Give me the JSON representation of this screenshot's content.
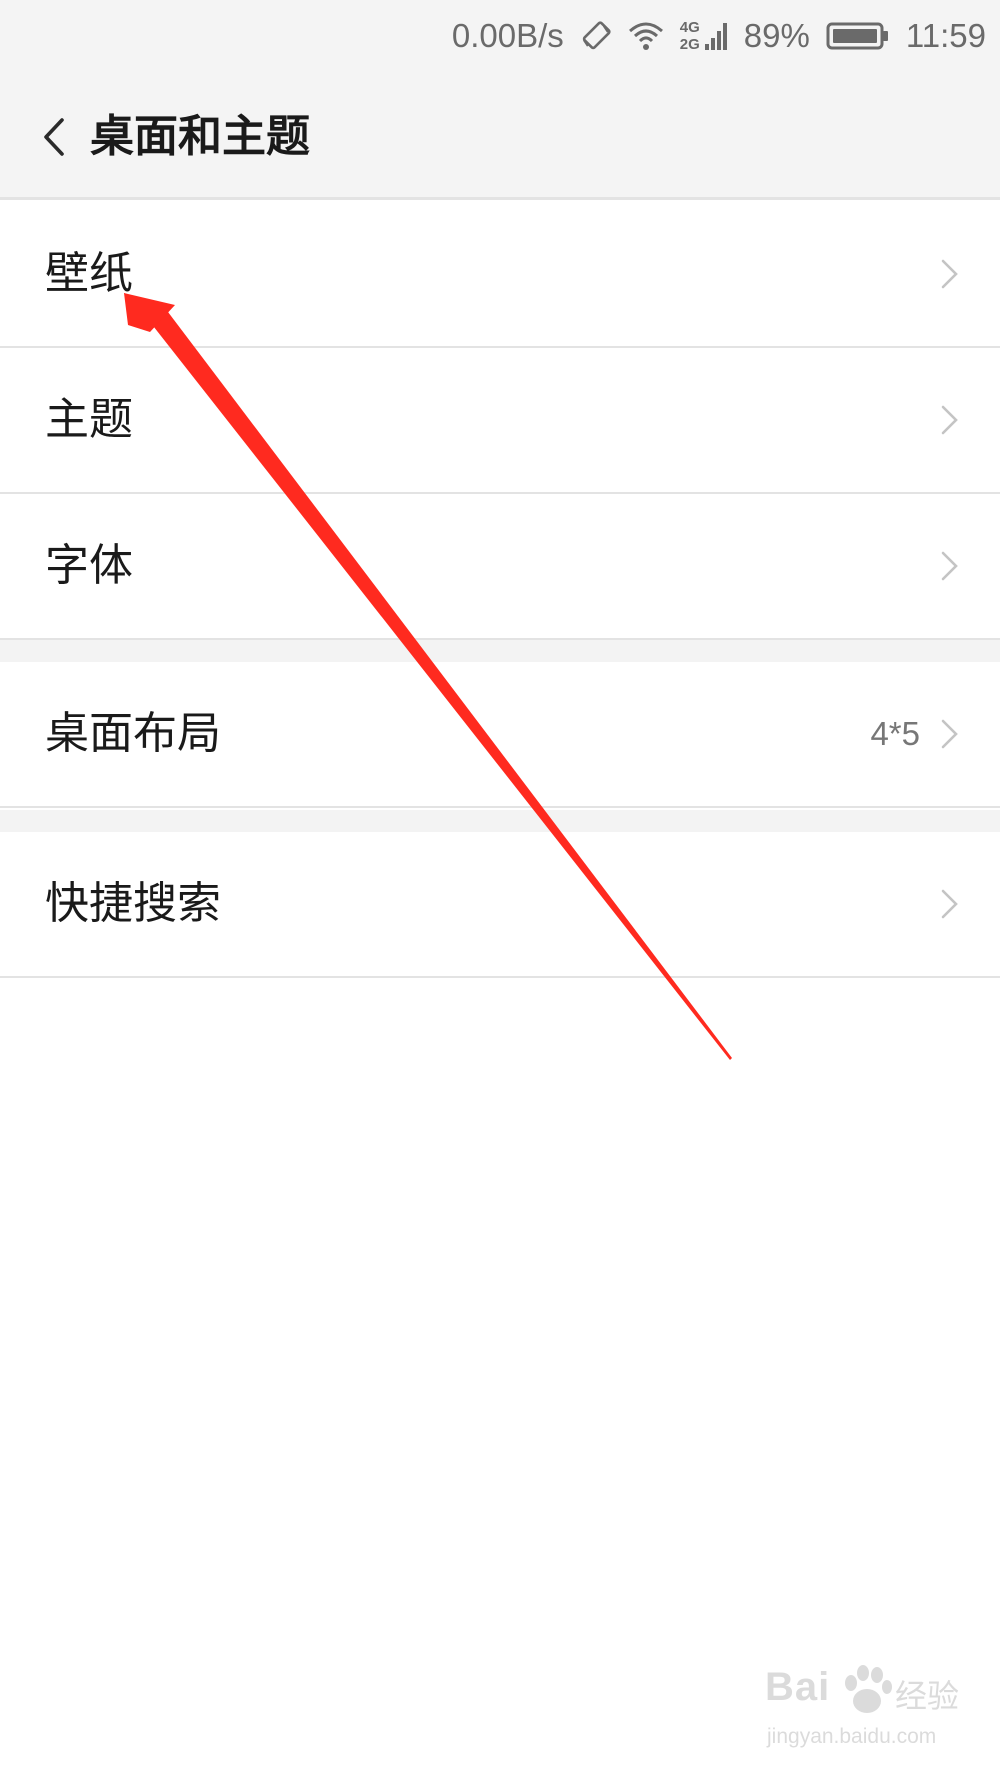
{
  "status_bar": {
    "speed": "0.00B/s",
    "network_top": "4G",
    "network_bottom": "2G",
    "battery": "89%",
    "time": "11:59",
    "icons": [
      "rotate-lock-icon",
      "wifi-icon",
      "cellular-signal-icon",
      "battery-icon"
    ]
  },
  "header": {
    "title": "桌面和主题",
    "back_icon": "back-arrow-icon"
  },
  "list": {
    "wallpaper": {
      "label": "壁纸"
    },
    "theme": {
      "label": "主题"
    },
    "font": {
      "label": "字体"
    },
    "desktop_layout": {
      "label": "桌面布局",
      "value": "4*5"
    },
    "quick_search": {
      "label": "快捷搜索"
    }
  },
  "annotation": {
    "color": "#ff2a1f"
  },
  "watermark": {
    "brand": "Bai",
    "brand2": "经验",
    "url": "jingyan.baidu.com"
  },
  "colors": {
    "background": "#ffffff",
    "header_bg": "#f4f4f4",
    "divider": "#e3e3e3",
    "text_primary": "#1a1a1a",
    "text_secondary": "#777777"
  }
}
